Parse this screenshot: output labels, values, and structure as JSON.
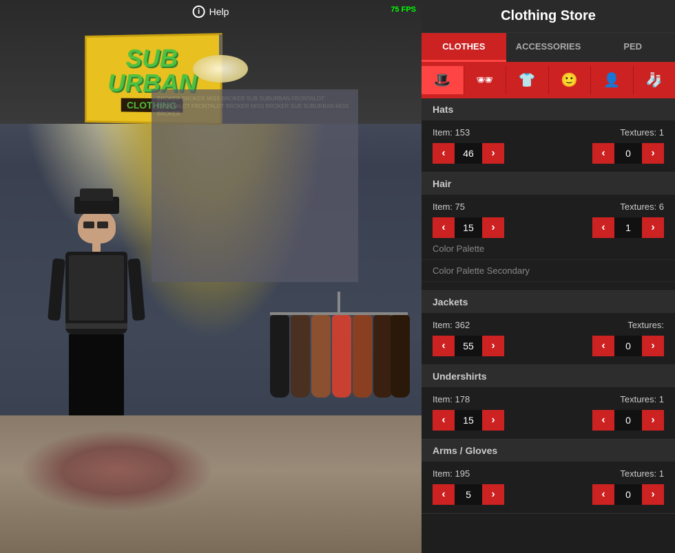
{
  "header": {
    "title": "Clothing Store",
    "fps": "75 FPS"
  },
  "help": {
    "label": "Help",
    "icon": "i"
  },
  "tabs": [
    {
      "id": "clothes",
      "label": "CLOTHES",
      "active": true
    },
    {
      "id": "accessories",
      "label": "ACCESSORIES",
      "active": false
    },
    {
      "id": "ped",
      "label": "PED",
      "active": false
    }
  ],
  "icons": [
    {
      "id": "hat",
      "symbol": "🎩",
      "selected": true
    },
    {
      "id": "glasses",
      "symbol": "🕶",
      "selected": false
    },
    {
      "id": "shirt",
      "symbol": "👕",
      "selected": false
    },
    {
      "id": "face",
      "symbol": "🙂",
      "selected": false
    },
    {
      "id": "person",
      "symbol": "👤",
      "selected": false
    },
    {
      "id": "socks",
      "symbol": "🧦",
      "selected": false
    }
  ],
  "sections": [
    {
      "id": "hats",
      "header": "Hats",
      "item_label": "Item: 153",
      "textures_label": "Textures: 1",
      "item_value": "46",
      "texture_value": "0",
      "has_palette": false,
      "has_palette_secondary": false
    },
    {
      "id": "hair",
      "header": "Hair",
      "item_label": "Item: 75",
      "textures_label": "Textures: 6",
      "item_value": "15",
      "texture_value": "1",
      "has_palette": true,
      "has_palette_secondary": true,
      "palette_label": "Color Palette",
      "palette_secondary_label": "Color Palette Secondary"
    },
    {
      "id": "jackets",
      "header": "Jackets",
      "item_label": "Item: 362",
      "textures_label": "Textures:",
      "item_value": "55",
      "texture_value": "0",
      "has_palette": false,
      "has_palette_secondary": false
    },
    {
      "id": "undershirts",
      "header": "Undershirts",
      "item_label": "Item: 178",
      "textures_label": "Textures: 1",
      "item_value": "15",
      "texture_value": "0",
      "has_palette": false,
      "has_palette_secondary": false
    },
    {
      "id": "arms-gloves",
      "header": "Arms / Gloves",
      "item_label": "Item: 195",
      "textures_label": "Textures: 1",
      "item_value": "5",
      "texture_value": "0",
      "has_palette": false,
      "has_palette_secondary": false
    }
  ],
  "colors": {
    "red": "#cc2222",
    "darkbg": "#1e1e1e",
    "sectionbg": "#2d2d2d"
  }
}
